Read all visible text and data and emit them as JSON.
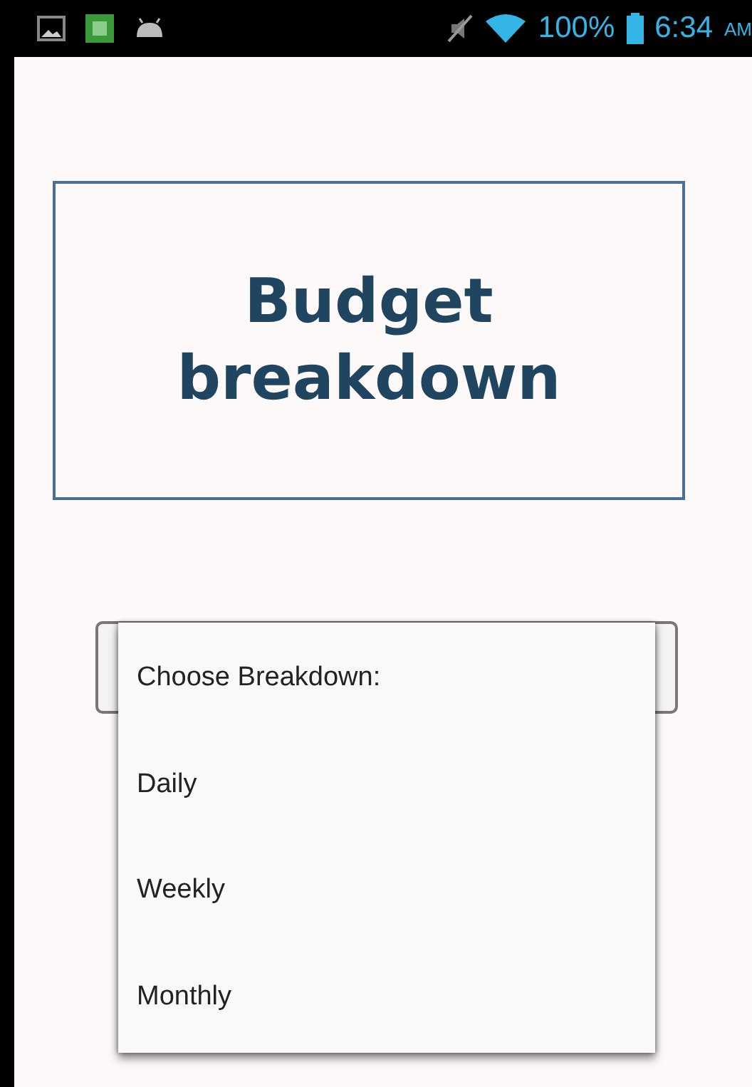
{
  "status_bar": {
    "battery": "100%",
    "time": "6:34",
    "meridiem": "AM"
  },
  "title": "Budget breakdown",
  "dropdown": {
    "expanded": true,
    "options": [
      {
        "label": "Choose Breakdown:",
        "selected": false
      },
      {
        "label": "Daily",
        "selected": false
      },
      {
        "label": "Weekly",
        "selected": false
      },
      {
        "label": "Monthly",
        "selected": false
      }
    ]
  }
}
